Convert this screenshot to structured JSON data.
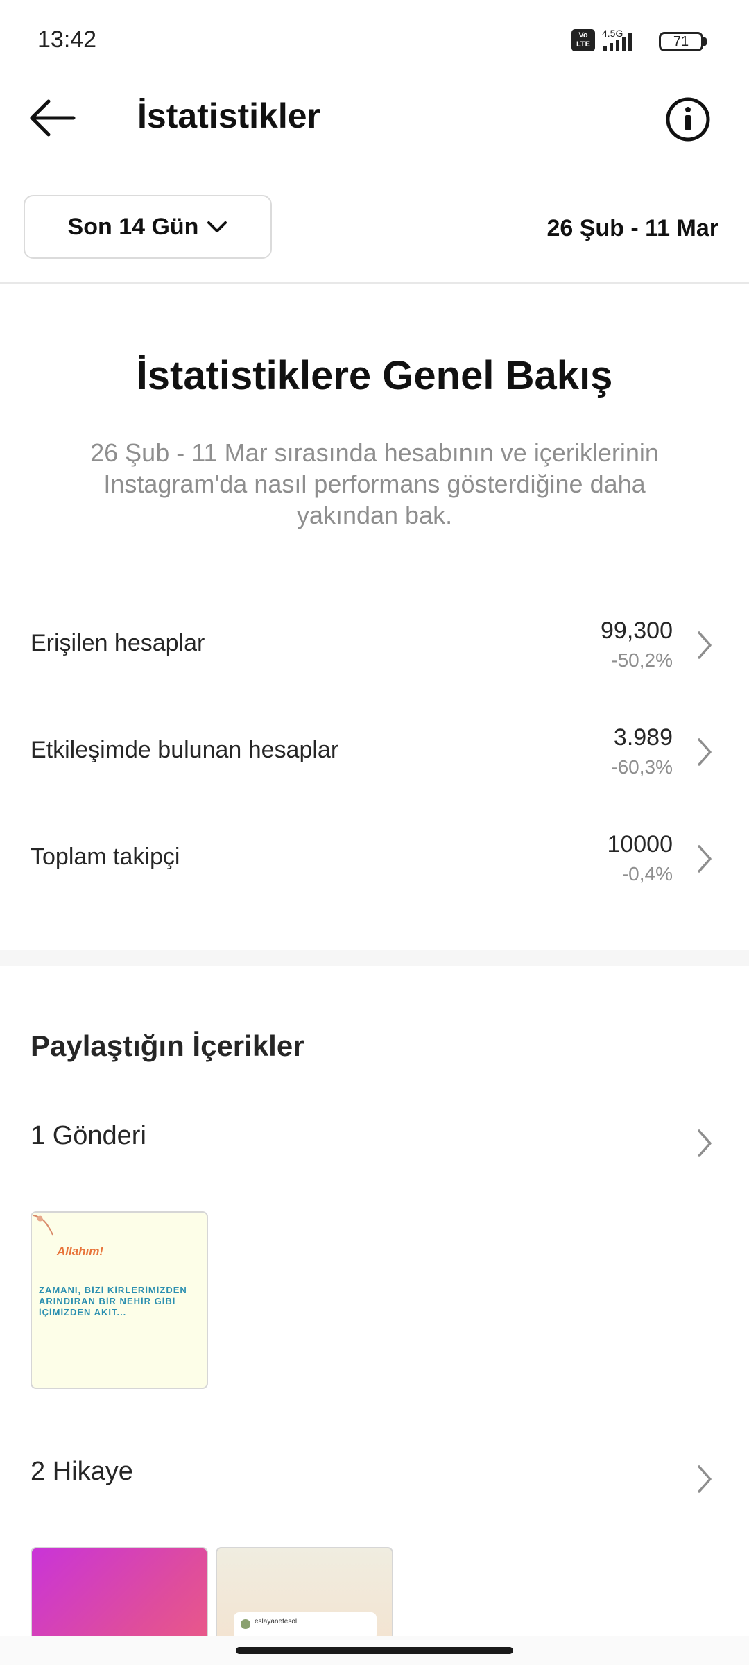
{
  "status_bar": {
    "time": "13:42",
    "volte": "Vo LTE",
    "network": "4.5G",
    "battery": "71"
  },
  "header": {
    "title": "İstatistikler",
    "back_icon": "arrow-left-icon",
    "info_icon": "info-circle-icon"
  },
  "filter": {
    "range_label": "Son 14 Gün",
    "date_range": "26 Şub - 11 Mar"
  },
  "overview": {
    "title": "İstatistiklere Genel Bakış",
    "description": "26 Şub - 11 Mar sırasında hesabının ve içeriklerinin Instagram'da nasıl performans gösterdiğine daha yakından bak."
  },
  "metrics": [
    {
      "label": "Erişilen hesaplar",
      "value": "99,300",
      "change": "-50,2%"
    },
    {
      "label": "Etkileşimde bulunan hesaplar",
      "value": "3.989",
      "change": "-60,3%"
    },
    {
      "label": "Toplam takipçi",
      "value": "10000",
      "change": "-0,4%"
    }
  ],
  "shared_content": {
    "title": "Paylaştığın İçerikler",
    "posts_label": "1 Gönderi",
    "stories_label": "2 Hikaye",
    "post_thumb": {
      "heading": "Allahım!",
      "body": "ZAMANI, BİZİ KİRLERİMİZDEN ARINDIRAN BİR NEHİR GİBİ İÇİMİZDEN AKIT..."
    },
    "story_thumb": {
      "username": "eslayanefesol"
    }
  }
}
